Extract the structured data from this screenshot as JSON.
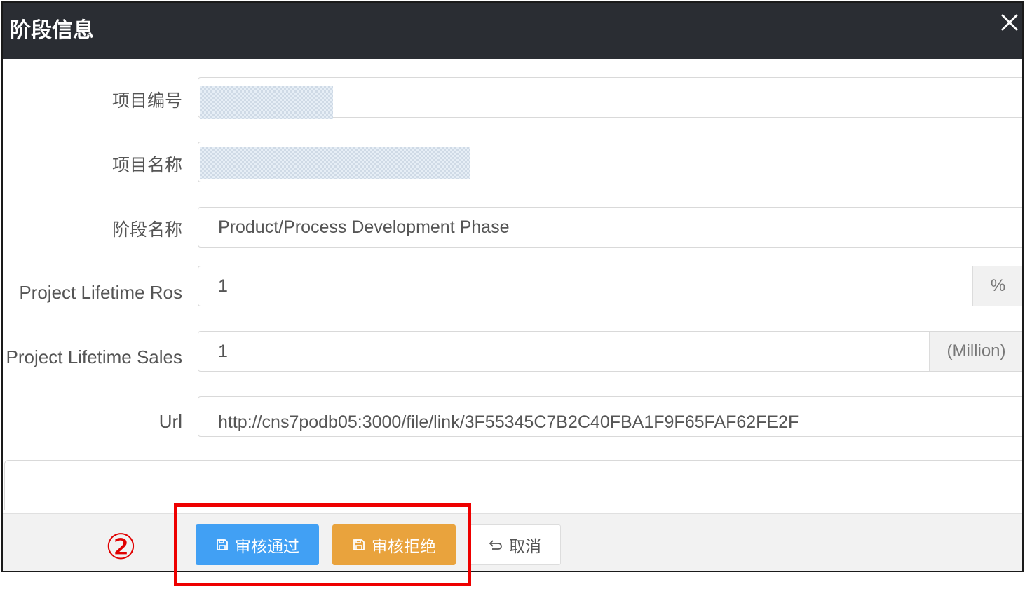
{
  "dialog": {
    "title": "阶段信息",
    "close_icon": "close-icon"
  },
  "form": {
    "project_no": {
      "label": "项目编号",
      "value": ""
    },
    "project_name": {
      "label": "项目名称",
      "value": ""
    },
    "phase_name": {
      "label": "阶段名称",
      "value": "Product/Process Development Phase"
    },
    "lifetime_ros": {
      "label": "Project Lifetime Ros",
      "value": "1",
      "unit": "%"
    },
    "lifetime_sales": {
      "label": "Project Lifetime Sales",
      "value": "1",
      "unit": "(Million)"
    },
    "url": {
      "label": "Url",
      "value": "http://cns7podb05:3000/file/link/3F55345C7B2C40FBA1F9F65FAF62FE2F"
    }
  },
  "footer": {
    "annotation_marker": "②",
    "approve_label": "审核通过",
    "reject_label": "审核拒绝",
    "cancel_label": "取消",
    "approve_icon": "save-icon",
    "reject_icon": "save-icon",
    "cancel_icon": "undo-icon"
  },
  "colors": {
    "titlebar": "#2a2d33",
    "approve": "#41a0f4",
    "reject": "#e9a33d",
    "highlight": "#ee0000"
  }
}
